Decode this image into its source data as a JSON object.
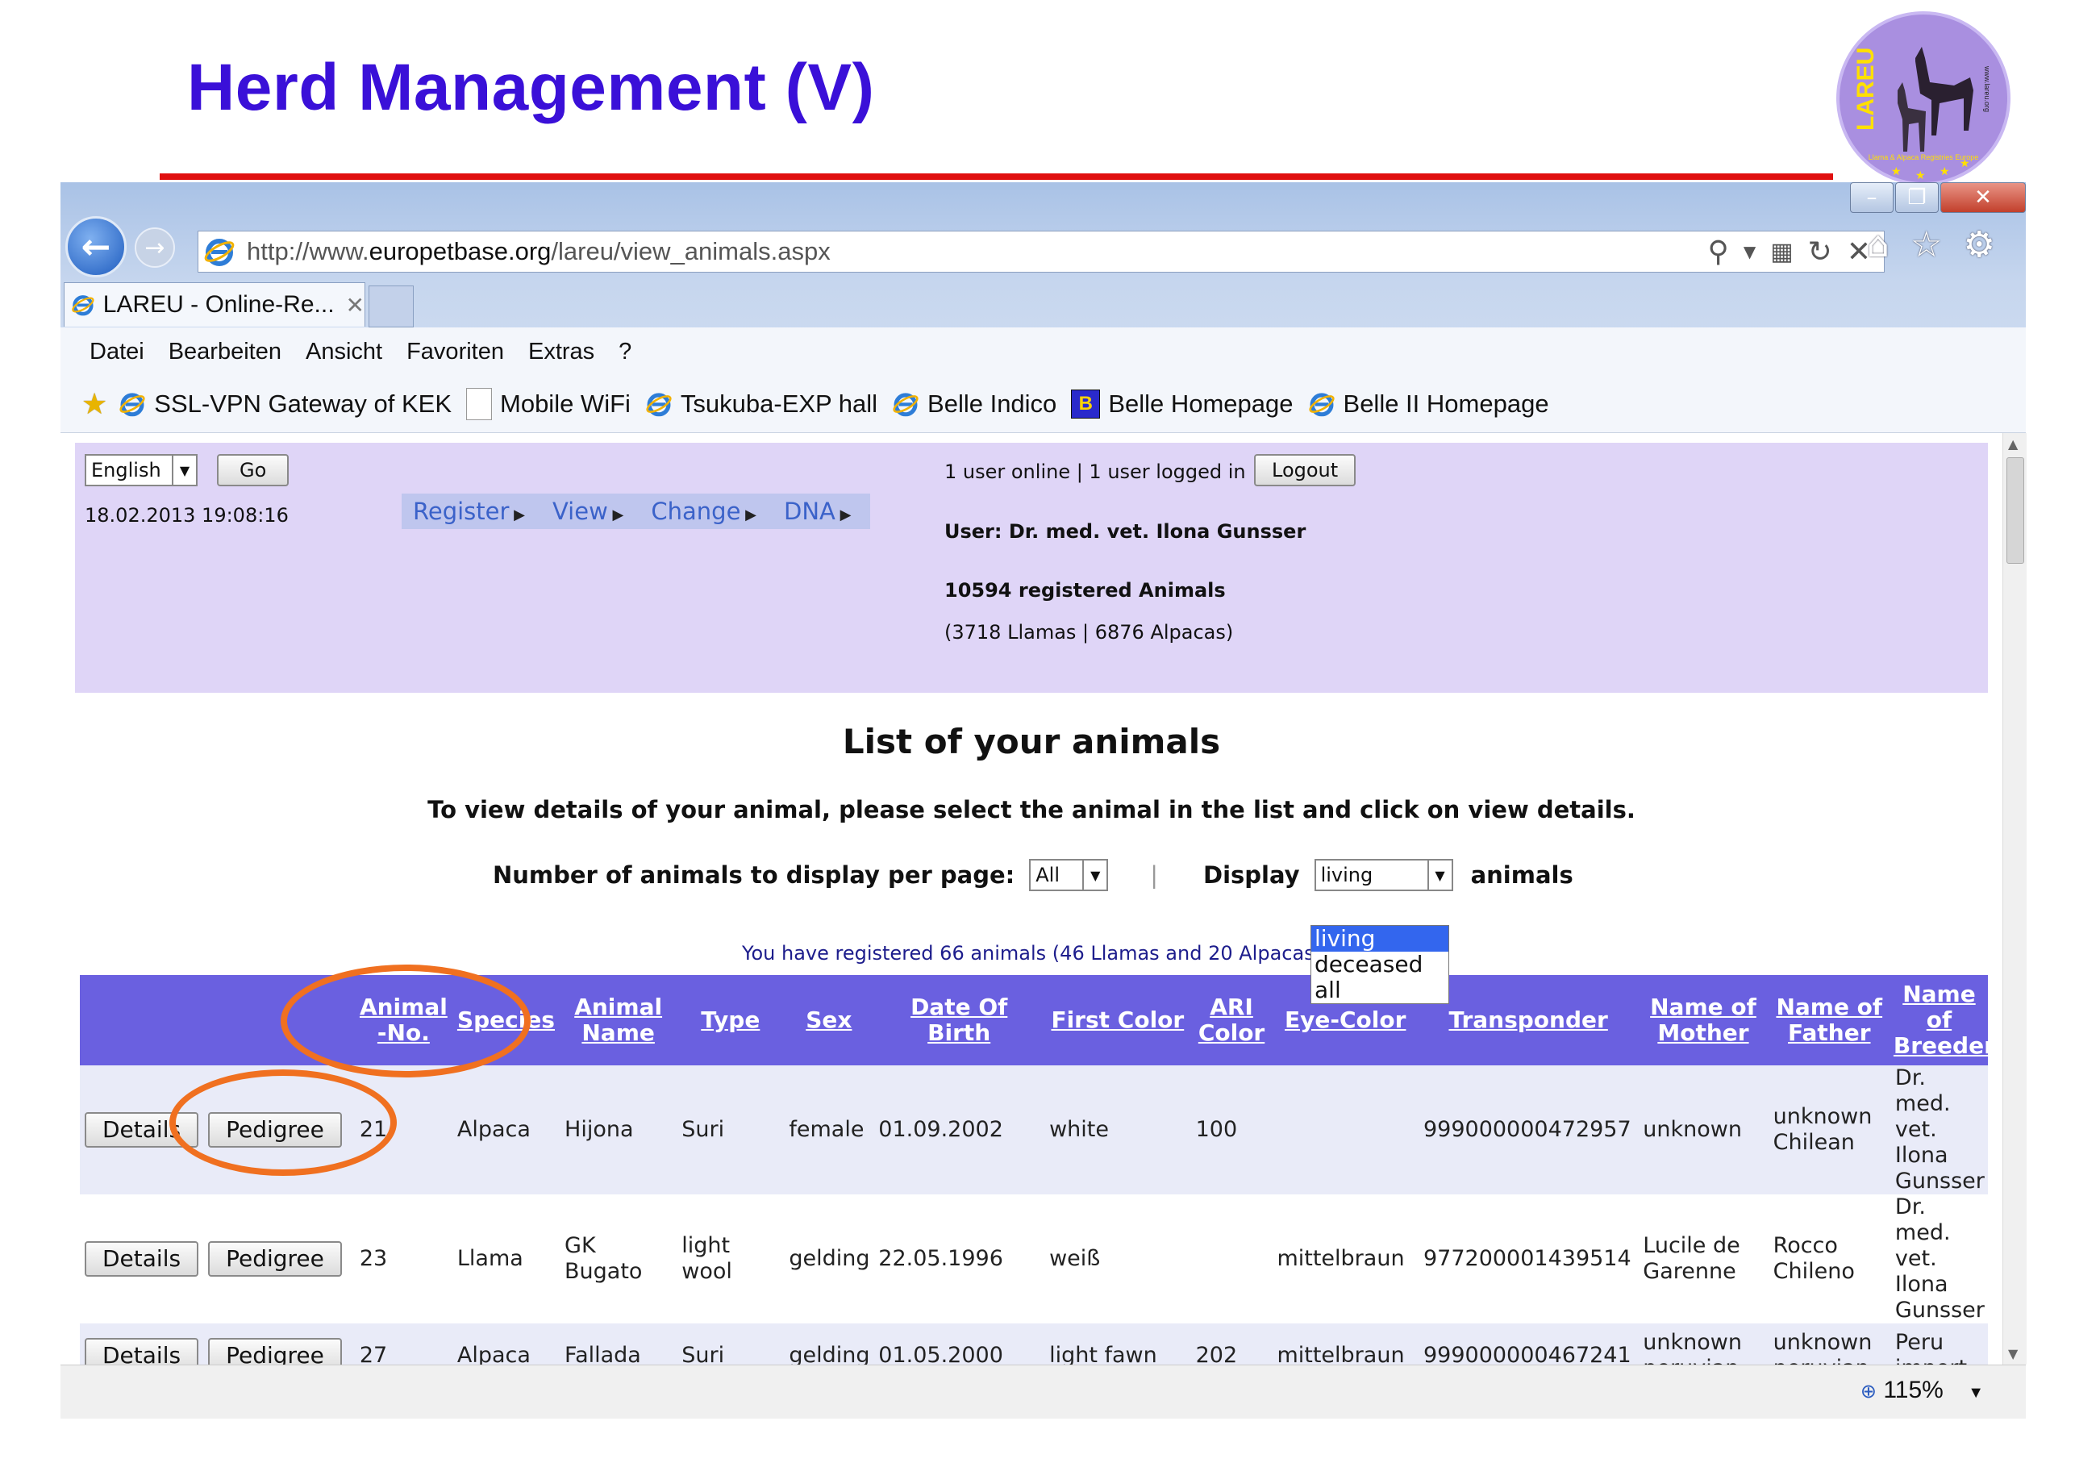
{
  "slide": {
    "title": "Herd Management (V)",
    "logo": {
      "main_text": "LAREU",
      "sub_text": "Llama & Alpaca Registries Europe",
      "side_text": "www.lareu.org"
    },
    "colors": {
      "title": "#3a10d8",
      "rule": "#e01010",
      "annotation": "#f07020"
    }
  },
  "browser": {
    "url_prefix": "http://www.",
    "url_domain": "europetbase.org",
    "url_path": "/lareu/view_animals.aspx",
    "tab_title": "LAREU - Online-Re...",
    "menu": [
      "Datei",
      "Bearbeiten",
      "Ansicht",
      "Favoriten",
      "Extras",
      "?"
    ],
    "favorites": [
      {
        "label": "SSL-VPN Gateway of KEK",
        "icon": "ie-icon"
      },
      {
        "label": "Mobile WiFi",
        "icon": "page-icon"
      },
      {
        "label": "Tsukuba-EXP hall",
        "icon": "ie-icon"
      },
      {
        "label": "Belle Indico",
        "icon": "ie-icon"
      },
      {
        "label": "Belle Homepage",
        "icon": "b-icon"
      },
      {
        "label": "Belle II Homepage",
        "icon": "ie-icon"
      }
    ],
    "zoom": "115%"
  },
  "page": {
    "language_value": "English",
    "go_label": "Go",
    "datetime": "18.02.2013 19:08:16",
    "nav": [
      "Register",
      "View",
      "Change",
      "DNA"
    ],
    "online_status": "1 user online | 1 user logged in",
    "logout_label": "Logout",
    "user": "User: Dr. med. vet. Ilona Gunsser",
    "registered_total": "10594 registered Animals",
    "registered_breakdown": "(3718 Llamas | 6876 Alpacas)",
    "list_title": "List of your animals",
    "instructions": "To view details of your animal, please select the animal in the list and click on view details.",
    "per_page_label": "Number of animals to display per page:",
    "per_page_value": "All",
    "separator": "|",
    "display_label": "Display",
    "display_value": "living",
    "display_options": [
      "living",
      "deceased",
      "all"
    ],
    "display_suffix": "animals",
    "registered_note": "You have registered 66 animals (46 Llamas and 20 Alpacas)",
    "colors": {
      "panel": "#dfd5f7",
      "table_header": "#6a60e0",
      "row_odd": "#e9ebf8",
      "nav_link": "#3b62c9"
    }
  },
  "table": {
    "columns": [
      "",
      "Animal -No.",
      "Species",
      "Animal Name",
      "Type",
      "Sex",
      "Date Of Birth",
      "First Color",
      "ARI Color",
      "Eye-Color",
      "Transponder",
      "Name of Mother",
      "Name of Father",
      "Name of Breeder"
    ],
    "details_label": "Details",
    "pedigree_label": "Pedigree",
    "rows": [
      {
        "no": "21",
        "species": "Alpaca",
        "name": "Hijona",
        "type": "Suri",
        "sex": "female",
        "dob": "01.09.2002",
        "first_color": "white",
        "ari": "100",
        "eye": "",
        "transponder": "999000000472957",
        "mother": "unknown",
        "father": "unknown Chilean",
        "breeder": "Dr. med. vet. Ilona Gunsser"
      },
      {
        "no": "23",
        "species": "Llama",
        "name": "GK Bugato",
        "type": "light wool",
        "sex": "gelding",
        "dob": "22.05.1996",
        "first_color": "weiß",
        "ari": "",
        "eye": "mittelbraun",
        "transponder": "977200001439514",
        "mother": "Lucile de Garenne",
        "father": "Rocco Chileno",
        "breeder": "Dr. med. vet. Ilona Gunsser"
      },
      {
        "no": "27",
        "species": "Alpaca",
        "name": "Fallada",
        "type": "Suri",
        "sex": "gelding",
        "dob": "01.05.2000",
        "first_color": "light fawn",
        "ari": "202",
        "eye": "mittelbraun",
        "transponder": "999000000467241",
        "mother": "unknown peruvian",
        "father": "unknown peruvian",
        "breeder": "Peru import"
      }
    ]
  }
}
